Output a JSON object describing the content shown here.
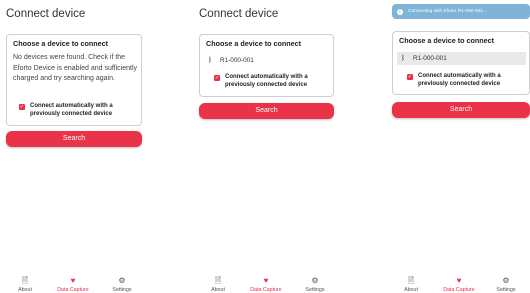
{
  "screen1": {
    "title": "Connect device",
    "card_title": "Choose a device to connect",
    "message": "No devices were found. Check if the Eforto Device is enabled and sufficiently charged and try searching again.",
    "checkbox_label": "Connect automatically with a previously connected device",
    "search_label": "Search"
  },
  "screen2": {
    "title": "Connect device",
    "card_title": "Choose a device to connect",
    "device": "R1-000-001",
    "checkbox_label": "Connect automatically with a previously connected device",
    "search_label": "Search"
  },
  "screen3": {
    "toast": "Connecting with Eforto R1-000-001...",
    "card_title": "Choose a device to connect",
    "device": "R1-000-001",
    "checkbox_label": "Connect automatically with a previously connected device",
    "search_label": "Search"
  },
  "nav": {
    "about": "About",
    "data_capture": "Data Capture",
    "settings": "Settings"
  },
  "colors": {
    "accent": "#e8324b",
    "toast": "#7fb4d8"
  }
}
